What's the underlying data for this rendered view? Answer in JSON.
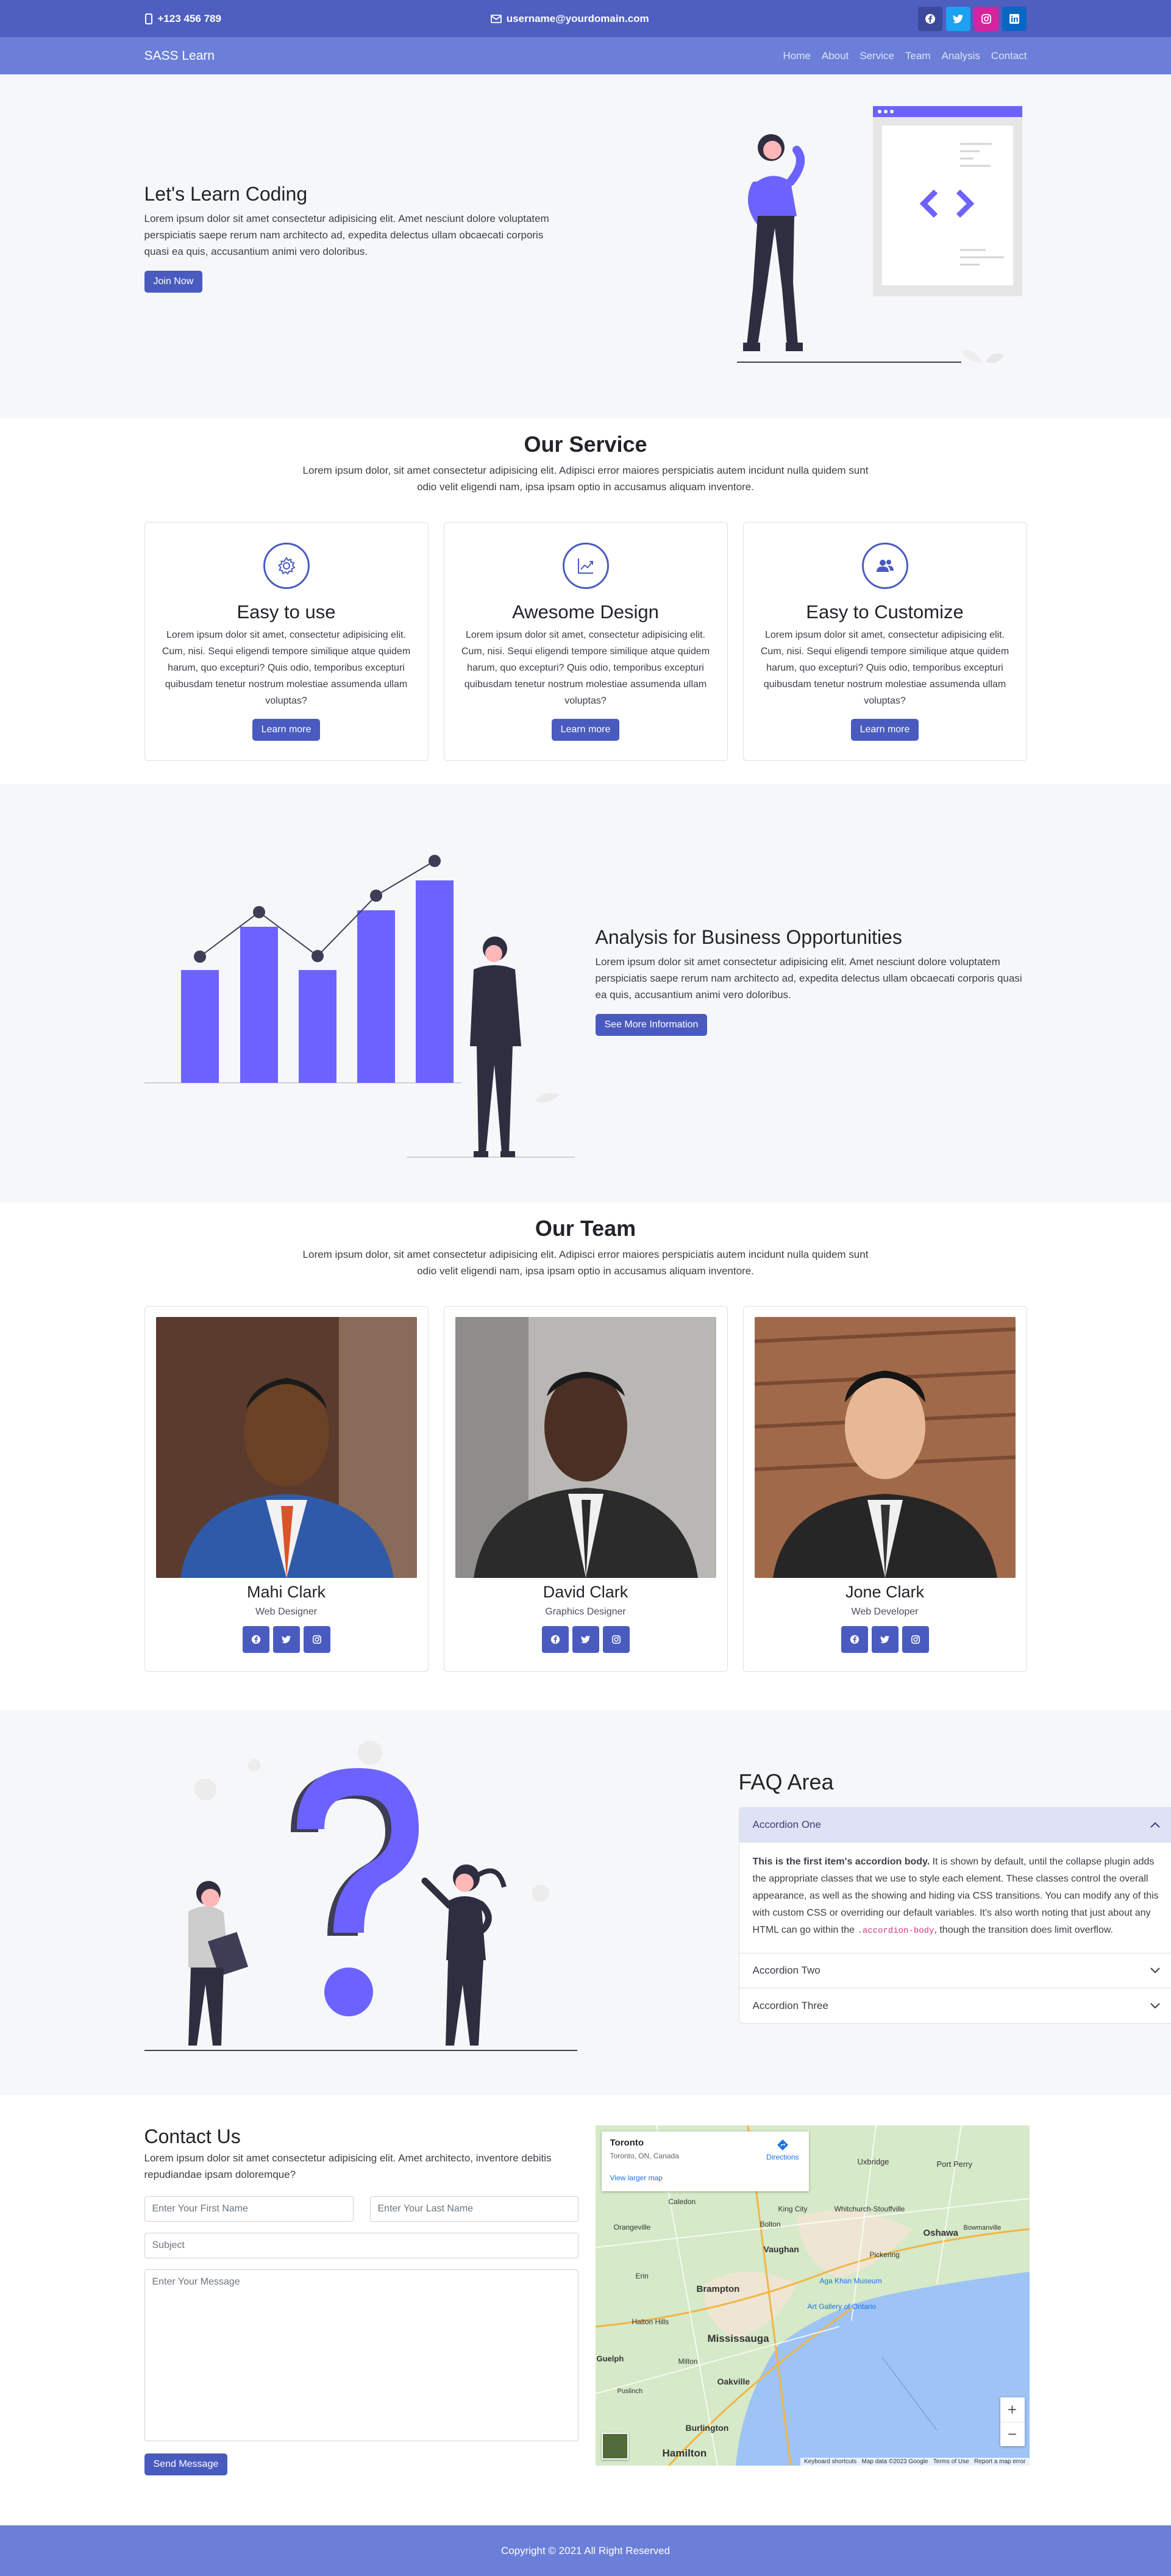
{
  "topbar": {
    "phone": "+123 456 789",
    "email": "username@yourdomain.com",
    "social_icons": [
      "facebook-icon",
      "twitter-icon",
      "instagram-icon",
      "linkedin-icon"
    ]
  },
  "nav": {
    "brand": "SASS Learn",
    "links": [
      "Home",
      "About",
      "Service",
      "Team",
      "Analysis",
      "Contact"
    ]
  },
  "hero": {
    "title": "Let's Learn Coding",
    "text": "Lorem ipsum dolor sit amet consectetur adipisicing elit. Amet nesciunt dolore voluptatem perspiciatis saepe rerum nam architecto ad, expedita delectus ullam obcaecati corporis quasi ea quis, accusantium animi vero doloribus.",
    "button": "Join Now"
  },
  "service": {
    "title": "Our Service",
    "subtitle": "Lorem ipsum dolor, sit amet consectetur adipisicing elit. Adipisci error maiores perspiciatis autem incidunt nulla quidem sunt odio velit eligendi nam, ipsa ipsam optio in accusamus aliquam inventore.",
    "cards": [
      {
        "icon": "gear-icon",
        "title": "Easy to use",
        "text": "Lorem ipsum dolor sit amet, consectetur adipisicing elit. Cum, nisi. Sequi eligendi tempore similique atque quidem harum, quo excepturi? Quis odio, temporibus excepturi quibusdam tenetur nostrum molestiae assumenda ullam voluptas?",
        "button": "Learn more"
      },
      {
        "icon": "chart-line-icon",
        "title": "Awesome Design",
        "text": "Lorem ipsum dolor sit amet, consectetur adipisicing elit. Cum, nisi. Sequi eligendi tempore similique atque quidem harum, quo excepturi? Quis odio, temporibus excepturi quibusdam tenetur nostrum molestiae assumenda ullam voluptas?",
        "button": "Learn more"
      },
      {
        "icon": "users-icon",
        "title": "Easy to Customize",
        "text": "Lorem ipsum dolor sit amet, consectetur adipisicing elit. Cum, nisi. Sequi eligendi tempore similique atque quidem harum, quo excepturi? Quis odio, temporibus excepturi quibusdam tenetur nostrum molestiae assumenda ullam voluptas?",
        "button": "Learn more"
      }
    ]
  },
  "analysis": {
    "title": "Analysis for Business Opportunities",
    "text": "Lorem ipsum dolor sit amet consectetur adipisicing elit. Amet nesciunt dolore voluptatem perspiciatis saepe rerum nam architecto ad, expedita delectus ullam obcaecati corporis quasi ea quis, accusantium animi vero doloribus.",
    "button": "See More Information"
  },
  "team": {
    "title": "Our Team",
    "subtitle": "Lorem ipsum dolor, sit amet consectetur adipisicing elit. Adipisci error maiores perspiciatis autem incidunt nulla quidem sunt odio velit eligendi nam, ipsa ipsam optio in accusamus aliquam inventore.",
    "members": [
      {
        "name": "Mahi Clark",
        "role": "Web Designer"
      },
      {
        "name": "David Clark",
        "role": "Graphics Designer"
      },
      {
        "name": "Jone Clark",
        "role": "Web Developer"
      }
    ]
  },
  "faq": {
    "title": "FAQ Area",
    "items": [
      {
        "label": "Accordion One",
        "open": true
      },
      {
        "label": "Accordion Two",
        "open": false
      },
      {
        "label": "Accordion Three",
        "open": false
      }
    ],
    "body_strong": "This is the first item's accordion body.",
    "body_text": " It is shown by default, until the collapse plugin adds the appropriate classes that we use to style each element. These classes control the overall appearance, as well as the showing and hiding via CSS transitions. You can modify any of this with custom CSS or overriding our default variables. It's also worth noting that just about any HTML can go within the ",
    "body_code": ".accordion-body",
    "body_end": ", though the transition does limit overflow."
  },
  "contact": {
    "title": "Contact Us",
    "text": "Lorem ipsum dolor sit amet consectetur adipisicing elit. Amet architecto, inventore debitis repudiandae ipsam doloremque?",
    "first_name_placeholder": "Enter Your First Name",
    "last_name_placeholder": "Enter Your Last Name",
    "subject_placeholder": "Subject",
    "message_placeholder": "Enter Your Message",
    "button": "Send Message",
    "map": {
      "place": "Toronto",
      "address": "Toronto, ON, Canada",
      "directions": "Directions",
      "larger": "View larger map",
      "cities": [
        "Uxbridge",
        "Port Perry",
        "Whitchurch-Stouffville",
        "Oshawa",
        "Bowmanville",
        "Vaughan",
        "Pickering",
        "Brampton",
        "Aga Khan Museum",
        "Art Gallery of Ontario",
        "Mississauga",
        "Oakville",
        "Burlington",
        "Hamilton",
        "Orangeville",
        "Bolton",
        "King City",
        "Erin",
        "Halton Hills",
        "Milton",
        "Guelph",
        "Puslinch",
        "Caledon"
      ],
      "footer": "Keyboard shortcuts   Map data ©2023 Google   Terms of Use   Report a map error",
      "zoom_in": "+",
      "zoom_out": "−"
    }
  },
  "footer": {
    "text": "Copyright © 2021 All Right Reserved"
  },
  "colors": {
    "primary": "#4a5bbf",
    "topbar": "#4f5fbf",
    "nav": "#6b7fd8",
    "accent_purple": "#6c63ff"
  }
}
